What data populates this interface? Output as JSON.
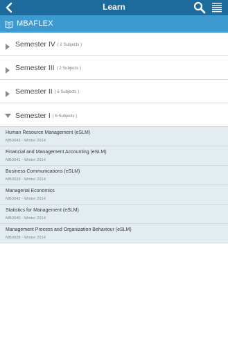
{
  "header": {
    "title": "Learn"
  },
  "brand": {
    "name": "MBAFLEX"
  },
  "semesters": [
    {
      "name": "Semester IV",
      "count": "( 2 Subjects )",
      "expanded": false
    },
    {
      "name": "Semester III",
      "count": "( 2 Subjects )",
      "expanded": false
    },
    {
      "name": "Semester II",
      "count": "( 6 Subjects )",
      "expanded": false
    },
    {
      "name": "Semester I",
      "count": "( 6 Subjects )",
      "expanded": true
    }
  ],
  "subjects": [
    {
      "name": "Human Resource Management (eSLM)",
      "code": "MB0043 - Winter 2014"
    },
    {
      "name": "Financial and Management Accounting (eSLM)",
      "code": "MB0041 - Winter 2014"
    },
    {
      "name": "Business Communications (eSLM)",
      "code": "MB0039 - Winter 2014"
    },
    {
      "name": "Managerial Economics",
      "code": "MB0042 - Winter 2014"
    },
    {
      "name": "Statistics for Management (eSLM)",
      "code": "MB0040 - Winter 2014"
    },
    {
      "name": "Management Process and Organization Behaviour (eSLM)",
      "code": "MB0038 - Winter 2014"
    }
  ],
  "icons": {
    "back": "chevron-left-icon",
    "search": "search-icon",
    "menu": "menu-icon",
    "brand": "book-icon",
    "collapsed": "triangle-right-icon",
    "expanded": "triangle-down-icon"
  },
  "colors": {
    "topbar": "#1d6a9c",
    "brandbar": "#3d9ad1",
    "subject_bg": "#e3ecf1"
  }
}
